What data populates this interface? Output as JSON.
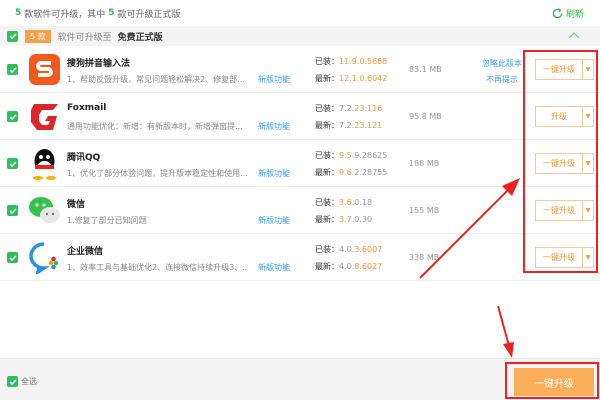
{
  "header": {
    "count1": "5",
    "text1": "款软件可升级，其中",
    "count2": "5",
    "text2": "款可升级正式版",
    "refresh": "刷新"
  },
  "group": {
    "badge": "5 款",
    "text": "软件可升级至",
    "target": "免费正式版"
  },
  "new_features": "新版功能",
  "installed_label": "已装：",
  "latest_label": "最新：",
  "ignore": {
    "line1": "忽略此版本",
    "line2": "不再提示"
  },
  "apps": [
    {
      "name": "搜狗拼音输入法",
      "desc": "1、帮助反馈升级，常见问题轻松解决2、修复部...",
      "inst": [
        "",
        "11.9.0.5688",
        ""
      ],
      "latest": [
        "",
        "12.1.0.6042",
        ""
      ],
      "size": "83.1 MB",
      "button": "一键升级"
    },
    {
      "name": "Foxmail",
      "desc": "通用功能优化：新增：有新版本时，新增弹窗提...",
      "inst": [
        "7.2.",
        "23.116",
        ""
      ],
      "latest": [
        "7.2.",
        "23.121",
        ""
      ],
      "size": "95.8 MB",
      "button": "升级"
    },
    {
      "name": "腾讯QQ",
      "desc": "1、优化了部分体验问题，提升版本稳定性和使用...",
      "inst": [
        "",
        "9.5.",
        "9.28625"
      ],
      "latest": [
        "",
        "9.6.",
        "2.28755"
      ],
      "size": "188 MB",
      "button": "一键升级"
    },
    {
      "name": "微信",
      "desc": "1.修复了部分已知问题",
      "inst": [
        "",
        "3.6.",
        "0.18"
      ],
      "latest": [
        "",
        "3.7.",
        "0.30"
      ],
      "size": "155 MB",
      "button": "一键升级"
    },
    {
      "name": "企业微信",
      "desc": "1、效率工具与基础优化2、连接微信持续升级3、...",
      "inst": [
        "4.0.",
        "3.6007",
        ""
      ],
      "latest": [
        "4.0.",
        "8.6027",
        ""
      ],
      "size": "338 MB",
      "button": "一键升级"
    }
  ],
  "footer": {
    "select_all": "全选",
    "upgrade_all": "一键升级"
  },
  "colors": {
    "green": "#2fbf5c",
    "orange": "#f5953a",
    "blue": "#3a9ee8",
    "annotation_red": "#f02020"
  }
}
